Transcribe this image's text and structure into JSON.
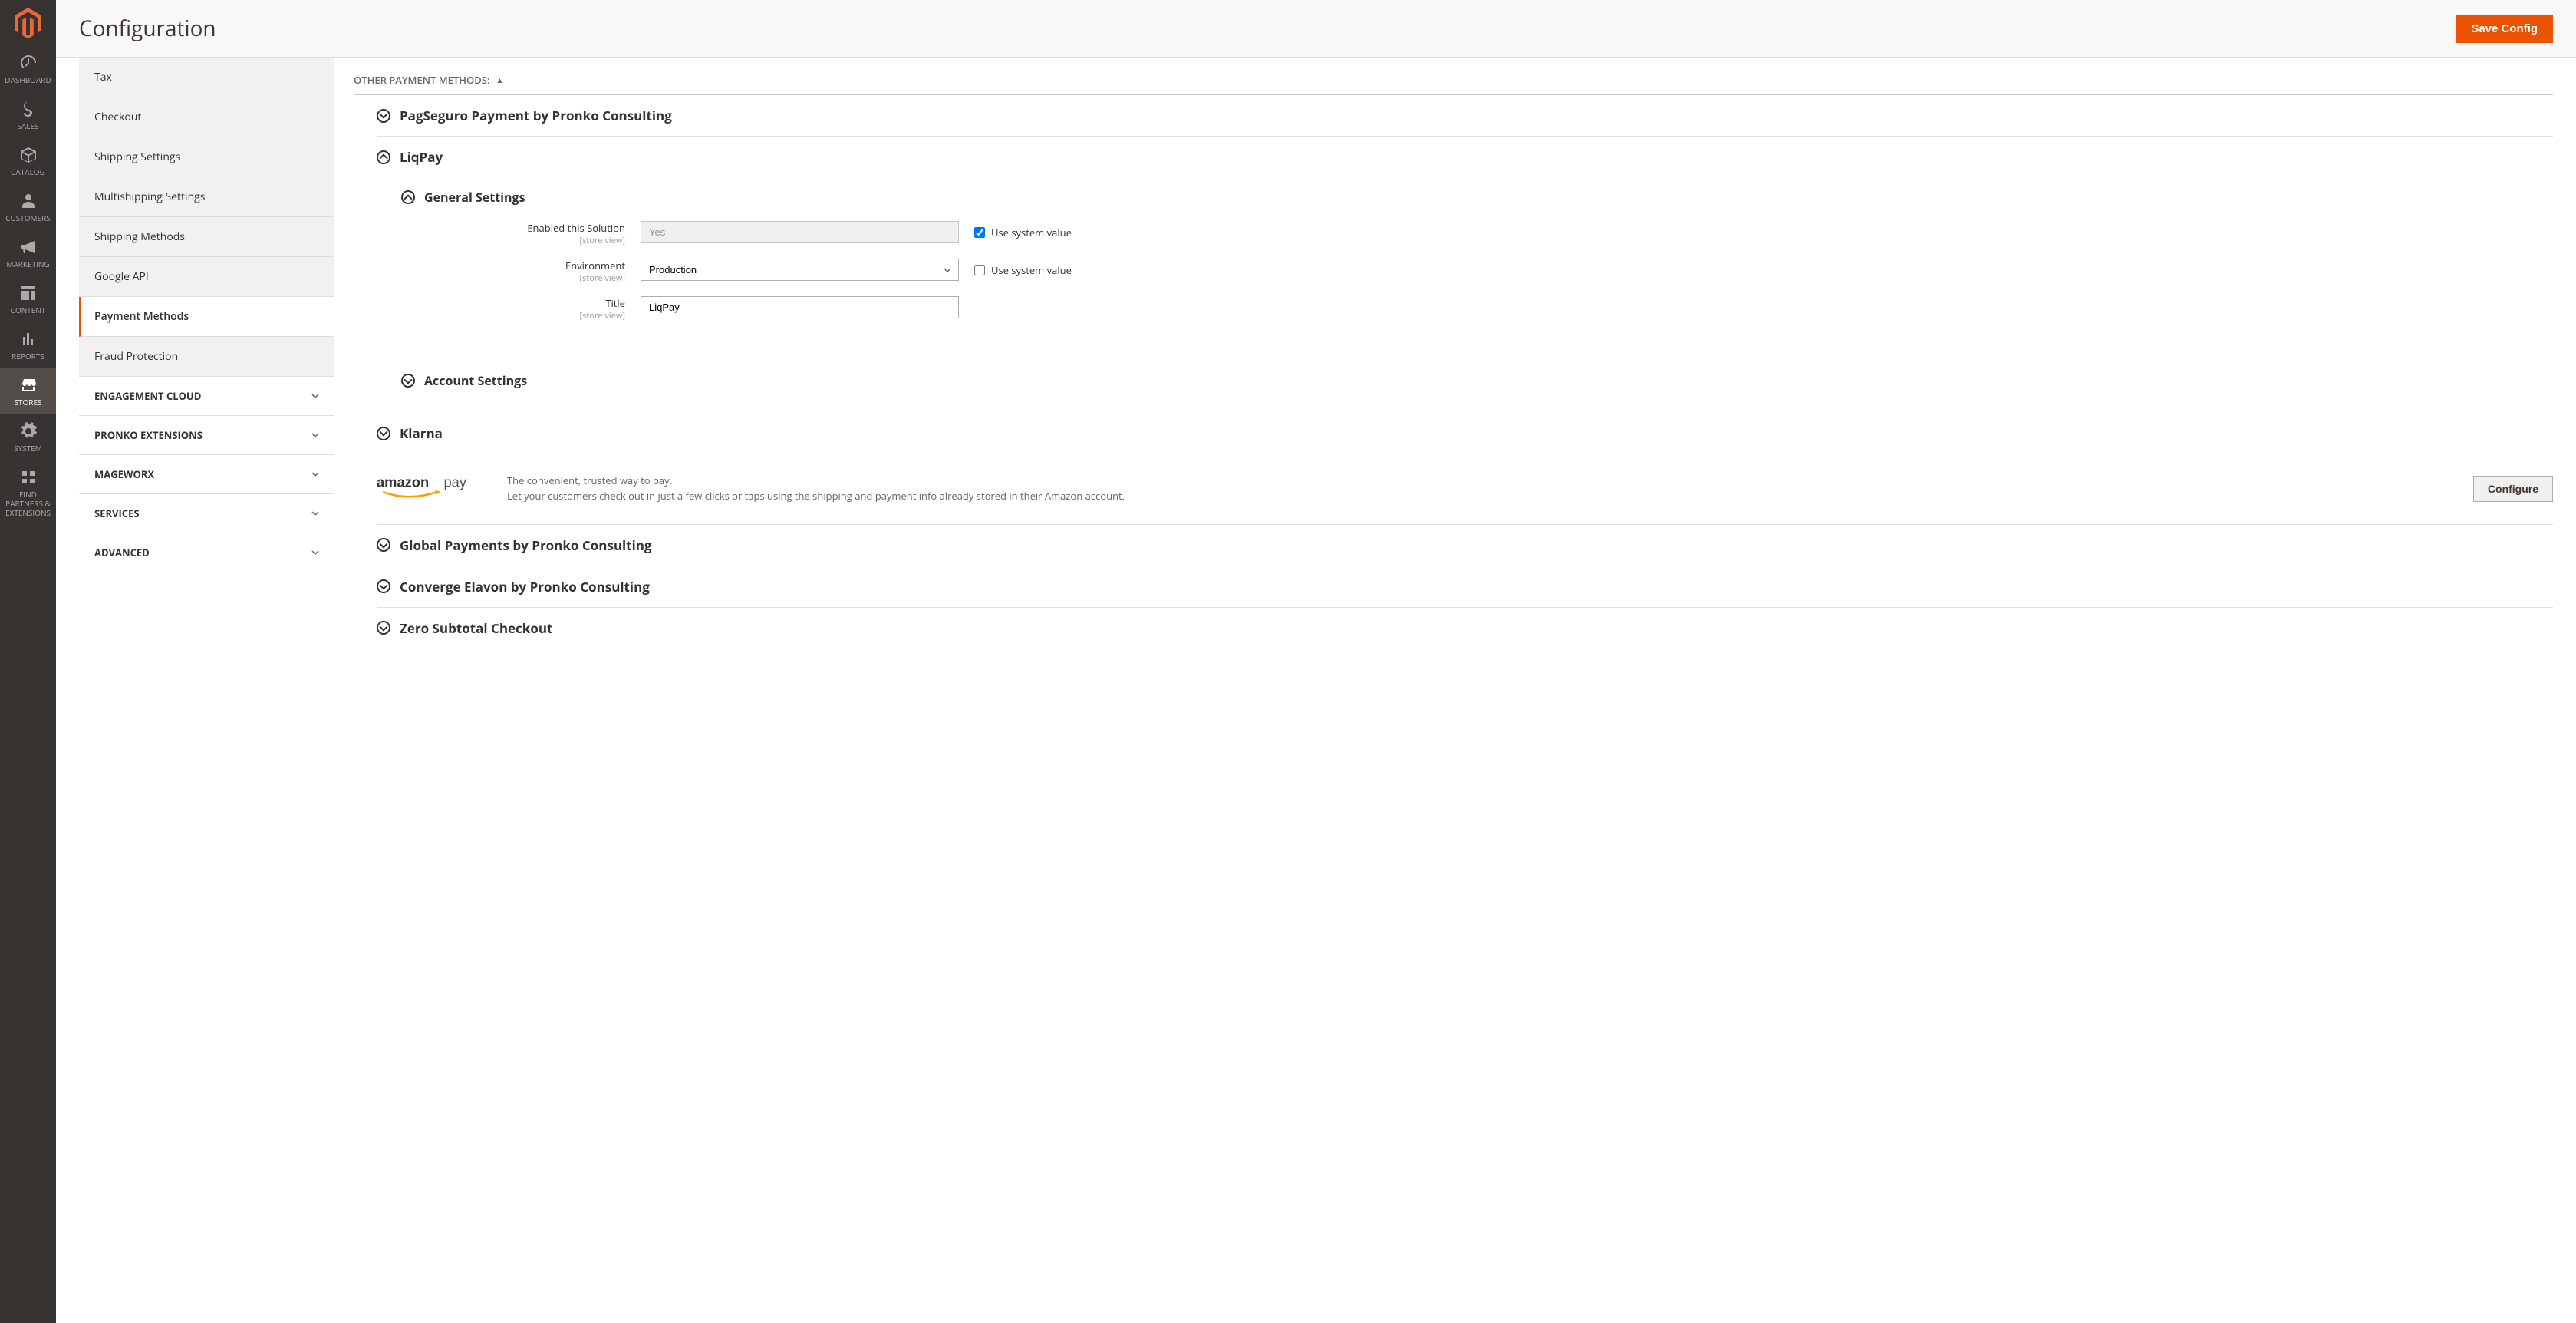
{
  "header": {
    "title": "Configuration",
    "save_button": "Save Config"
  },
  "left_nav": {
    "items": [
      {
        "label": "Dashboard",
        "icon": "dashboard"
      },
      {
        "label": "Sales",
        "icon": "dollar"
      },
      {
        "label": "Catalog",
        "icon": "box"
      },
      {
        "label": "Customers",
        "icon": "person"
      },
      {
        "label": "Marketing",
        "icon": "megaphone"
      },
      {
        "label": "Content",
        "icon": "layout"
      },
      {
        "label": "Reports",
        "icon": "chart"
      },
      {
        "label": "Stores",
        "icon": "storefront"
      },
      {
        "label": "System",
        "icon": "gear"
      },
      {
        "label": "Find Partners & Extensions",
        "icon": "extensions"
      }
    ]
  },
  "config_sidebar": {
    "items": [
      {
        "label": "Tax",
        "type": "item"
      },
      {
        "label": "Checkout",
        "type": "item"
      },
      {
        "label": "Shipping Settings",
        "type": "item"
      },
      {
        "label": "Multishipping Settings",
        "type": "item"
      },
      {
        "label": "Shipping Methods",
        "type": "item"
      },
      {
        "label": "Google API",
        "type": "item"
      },
      {
        "label": "Payment Methods",
        "type": "item",
        "active": true
      },
      {
        "label": "Fraud Protection",
        "type": "item"
      },
      {
        "label": "Engagement Cloud",
        "type": "group"
      },
      {
        "label": "Pronko Extensions",
        "type": "group"
      },
      {
        "label": "Mageworx",
        "type": "group"
      },
      {
        "label": "Services",
        "type": "group"
      },
      {
        "label": "Advanced",
        "type": "group"
      }
    ]
  },
  "main_section": {
    "header": "Other Payment Methods:",
    "payment_methods": [
      {
        "title": "PagSeguro Payment by Pronko Consulting",
        "expanded": false
      },
      {
        "title": "LiqPay",
        "expanded": true
      },
      {
        "title": "Klarna",
        "expanded": false
      },
      {
        "title": "Global Payments by Pronko Consulting",
        "expanded": false
      },
      {
        "title": "Converge Elavon by Pronko Consulting",
        "expanded": false
      },
      {
        "title": "Zero Subtotal Checkout",
        "expanded": false
      }
    ],
    "liqpay": {
      "general_settings_title": "General Settings",
      "account_settings_title": "Account Settings",
      "fields": {
        "enabled": {
          "label": "Enabled this Solution",
          "scope": "[store view]",
          "value": "Yes",
          "use_system": true
        },
        "environment": {
          "label": "Environment",
          "scope": "[store view]",
          "value": "Production",
          "use_system": false
        },
        "title": {
          "label": "Title",
          "scope": "[store view]",
          "value": "LiqPay"
        }
      }
    },
    "amazon": {
      "line1": "The convenient, trusted way to pay.",
      "line2": "Let your customers check out in just a few clicks or taps using the shipping and payment info already stored in their Amazon account.",
      "configure_button": "Configure"
    },
    "use_system_value_label": "Use system value"
  }
}
